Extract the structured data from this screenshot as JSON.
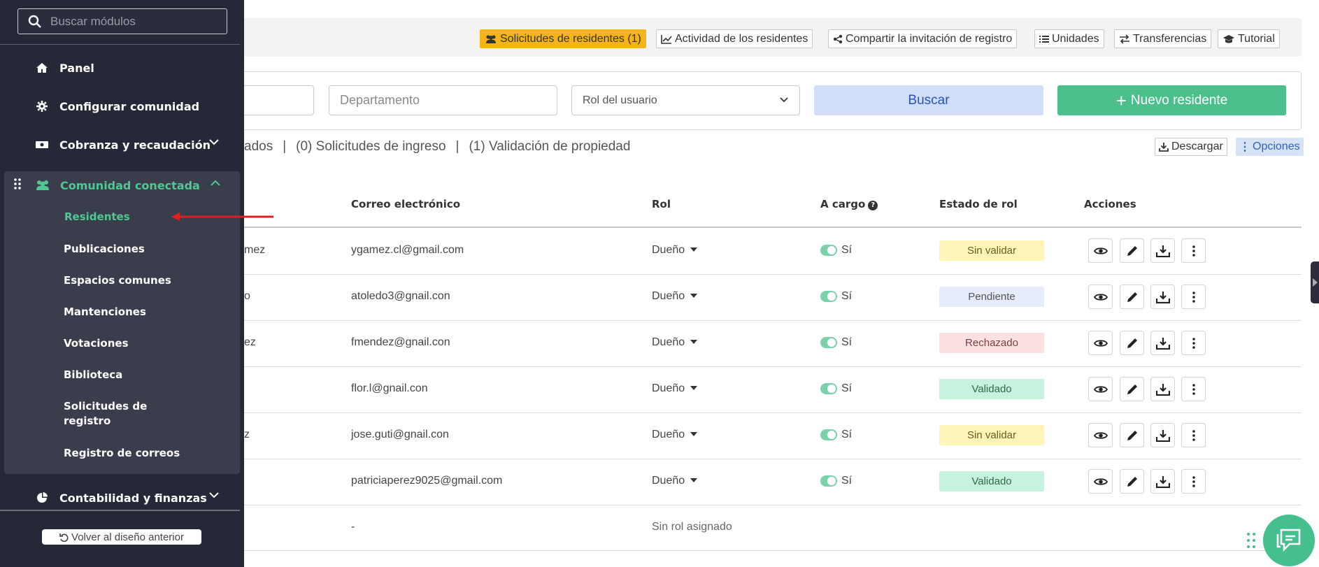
{
  "sidebar": {
    "search_placeholder": "Buscar módulos",
    "items": [
      {
        "label": "Panel",
        "icon": "home-icon"
      },
      {
        "label": "Configurar comunidad",
        "icon": "gear-icon"
      },
      {
        "label": "Cobranza y recaudación",
        "icon": "money-icon"
      }
    ],
    "group": {
      "label": "Comunidad conectada",
      "icon": "users-icon",
      "subitems": [
        "Residentes",
        "Publicaciones",
        "Espacios comunes",
        "Mantenciones",
        "Votaciones",
        "Biblioteca",
        "Solicitudes de registro",
        "Registro de correos"
      ]
    },
    "after_group": {
      "label": "Contabilidad y finanzas",
      "icon": "pie-chart-icon"
    },
    "bottom_button": "Volver al diseño anterior"
  },
  "top_tabs": [
    {
      "label": "Solicitudes de residentes (1)",
      "icon": "users-icon"
    },
    {
      "label": "Actividad de los residentes",
      "icon": "line-chart-icon"
    },
    {
      "label": "Compartir la invitación de registro",
      "icon": "share-icon"
    },
    {
      "label": "Unidades",
      "icon": "list-icon"
    },
    {
      "label": "Transferencias",
      "icon": "exchange-icon"
    },
    {
      "label": "Tutorial",
      "icon": "graduation-cap-icon"
    }
  ],
  "filters": {
    "departamento_placeholder": "Departamento",
    "rol_placeholder": "Rol del usuario",
    "search_button": "Buscar",
    "new_button": "Nuevo residente"
  },
  "stats": {
    "part1": "ados",
    "sep": "|",
    "part2": "(0) Solicitudes de ingreso",
    "part3": "(1) Validación de propiedad"
  },
  "download_button": "Descargar",
  "options_button": "Opciones",
  "table": {
    "headers": [
      "Correo electrónico",
      "Rol",
      "A cargo",
      "Estado de rol",
      "Acciones"
    ],
    "rows": [
      {
        "name": "mez",
        "email": "ygamez.cl@gmail.com",
        "rol": "Dueño",
        "cargo": "Sí",
        "estado": "Sin validar",
        "status": "warn"
      },
      {
        "name": "o",
        "email": "atoledo3@gnail.con",
        "rol": "Dueño",
        "cargo": "Sí",
        "estado": "Pendiente",
        "status": "pend"
      },
      {
        "name": "ez",
        "email": "fmendez@gnail.con",
        "rol": "Dueño",
        "cargo": "Sí",
        "estado": "Rechazado",
        "status": "rech"
      },
      {
        "name": "",
        "email": "flor.l@gnail.con",
        "rol": "Dueño",
        "cargo": "Sí",
        "estado": "Validado",
        "status": "ok"
      },
      {
        "name": "z",
        "email": "jose.guti@gnail.con",
        "rol": "Dueño",
        "cargo": "Sí",
        "estado": "Sin validar",
        "status": "warn"
      },
      {
        "name": "",
        "email": "patriciaperez9025@gmail.com",
        "rol": "Dueño",
        "cargo": "Sí",
        "estado": "Validado",
        "status": "ok"
      }
    ],
    "last_row": {
      "email": "-",
      "rol": "Sin rol asignado"
    }
  },
  "colors": {
    "sidebar_bg": "#252836",
    "accent_green": "#4fc892",
    "highlight_tab": "#f5b41a",
    "search_btn_bg": "#d2ddf8",
    "new_btn_bg": "#4dbf8c"
  }
}
